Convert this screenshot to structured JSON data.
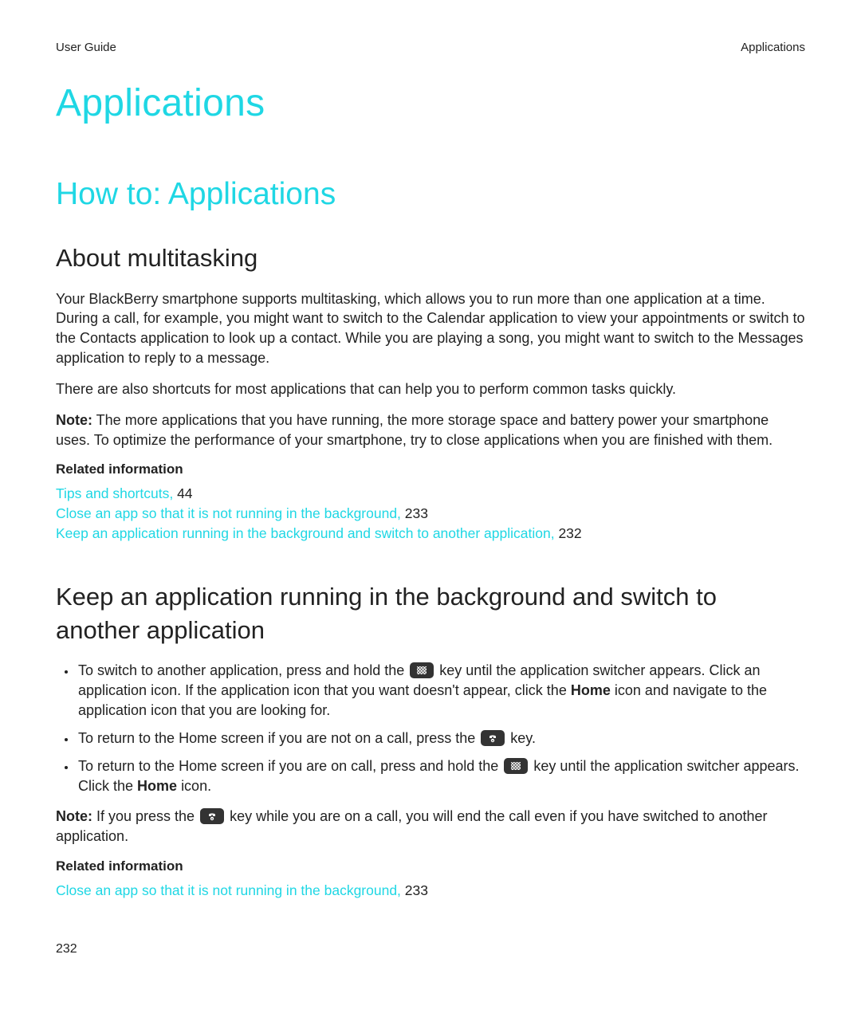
{
  "header": {
    "left": "User Guide",
    "right": "Applications"
  },
  "title": "Applications",
  "section": "How to: Applications",
  "about": {
    "heading": "About multitasking",
    "p1": "Your BlackBerry smartphone supports multitasking, which allows you to run more than one application at a time. During a call, for example, you might want to switch to the Calendar application to view your appointments or switch to the Contacts application to look up a contact. While you are playing a song, you might want to switch to the Messages application to reply to a message.",
    "p2": "There are also shortcuts for most applications that can help you to perform common tasks quickly.",
    "note_label": "Note:",
    "note_body": " The more applications that you have running, the more storage space and battery power your smartphone uses. To optimize the performance of your smartphone, try to close applications when you are finished with them.",
    "related_h": "Related information",
    "links": [
      {
        "text": "Tips and shortcuts,",
        "page": " 44"
      },
      {
        "text": "Close an app so that it is not running in the background,",
        "page": " 233"
      },
      {
        "text": "Keep an application running in the background and switch to another application,",
        "page": " 232"
      }
    ]
  },
  "keep": {
    "heading": "Keep an application running in the background and switch to another application",
    "b1a": "To switch to another application, press and hold the ",
    "b1b": " key until the application switcher appears. Click an application icon. If the application icon that you want doesn't appear, click the ",
    "b1_home": "Home",
    "b1c": " icon and navigate to the application icon that you are looking for.",
    "b2a": "To return to the Home screen if you are not on a call, press the ",
    "b2b": " key.",
    "b3a": "To return to the Home screen if you are on call, press and hold the ",
    "b3b": " key until the application switcher appears. Click the ",
    "b3_home": "Home",
    "b3c": " icon.",
    "note_label": "Note:",
    "note_a": " If you press the ",
    "note_b": " key while you are on a call, you will end the call even if you have switched to another application.",
    "related_h": "Related information",
    "link_text": "Close an app so that it is not running in the background,",
    "link_page": " 233"
  },
  "page_number": "232"
}
